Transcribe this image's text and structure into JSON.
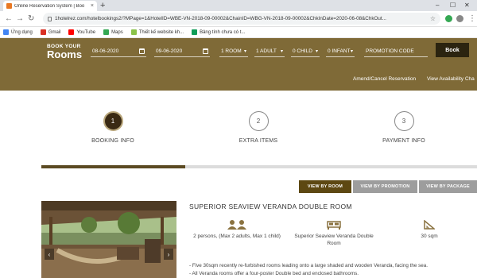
{
  "browser": {
    "tab_title": "Online Reservation System | Boo",
    "tab_close": "×",
    "new_tab": "+",
    "url": "1hotelrez.com/hotelbookings2/?MPage=1&HotelID=WBE-VN-2018-09-00002&ChainID=WBG-VN-2018-09-00002&ChkInDate=2020-06-08&ChkOut...",
    "bookmarks": [
      {
        "label": "Ứng dụng",
        "color": "#4285f4"
      },
      {
        "label": "Gmail",
        "color": "#d93025"
      },
      {
        "label": "YouTube",
        "color": "#ff0000"
      },
      {
        "label": "Maps",
        "color": "#34a853"
      },
      {
        "label": "Thiết kế website kh...",
        "color": "#8bc34a"
      },
      {
        "label": "Bảng tính chưa có t...",
        "color": "#0f9d58"
      }
    ]
  },
  "booking": {
    "brand_top": "BOOK YOUR",
    "brand_main": "Rooms",
    "checkin": "08-06-2020",
    "checkout": "09-06-2020",
    "rooms": "1 ROOM",
    "adults": "1 ADULT",
    "children": "0 CHILD",
    "infants": "0 INFANT",
    "promo_placeholder": "PROMOTION CODE",
    "book_label": "Book",
    "amend_link": "Amend/Cancel Reservation",
    "availability_link": "View Availability Cha",
    "accent_color": "#7f6a37"
  },
  "steps": [
    {
      "number": "1",
      "label": "BOOKING INFO",
      "active": true
    },
    {
      "number": "2",
      "label": "EXTRA ITEMS",
      "active": false
    },
    {
      "number": "3",
      "label": "PAYMENT INFO",
      "active": false
    }
  ],
  "progress": {
    "fraction": 0.33
  },
  "view_tabs": [
    {
      "label": "VIEW BY ROOM",
      "active": true
    },
    {
      "label": "VIEW BY PROMOTION",
      "active": false
    },
    {
      "label": "VIEW BY PACKAGE",
      "active": false
    }
  ],
  "room": {
    "title": "SUPERIOR SEAVIEW VERANDA DOUBLE ROOM",
    "occupancy": "2 persons, (Max 2 adults, Max 1 child)",
    "bed_type_line1": "Superior Seaview Veranda Double",
    "bed_type_line2": "Room",
    "size": "30 sqm",
    "description": [
      "- Five 30sqm recently re-furbished rooms leading onto a large shaded and wooden Veranda, facing the sea.",
      "- All Veranda rooms offer a four-poster Double bed and enclosed bathrooms."
    ],
    "photo_prev": "‹",
    "photo_next": "›"
  }
}
